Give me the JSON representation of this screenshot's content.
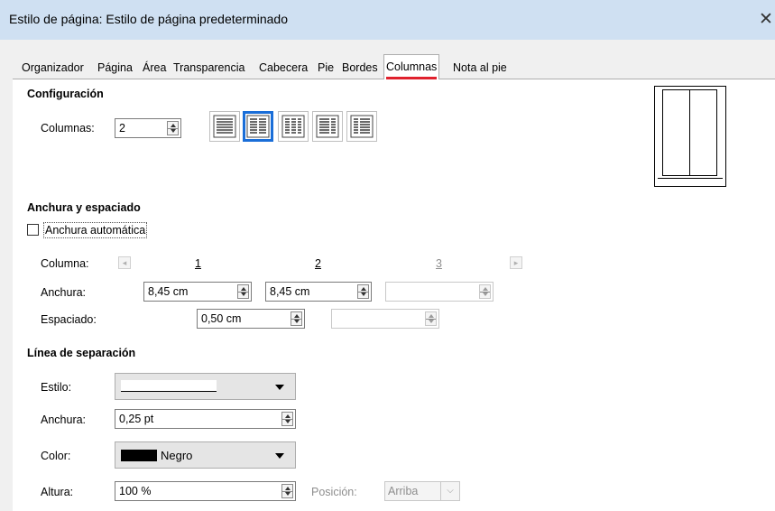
{
  "window": {
    "title": "Estilo de página: Estilo de página predeterminado",
    "close": "✕"
  },
  "tabs": [
    {
      "label": "Organizador"
    },
    {
      "label": "Página"
    },
    {
      "label": "Área"
    },
    {
      "label": "Transparencia"
    },
    {
      "label": "Cabecera"
    },
    {
      "label": "Pie"
    },
    {
      "label": "Bordes"
    },
    {
      "label": "Columnas",
      "active": true
    },
    {
      "label": "Nota al pie"
    }
  ],
  "configuracion": {
    "heading": "Configuración",
    "columns_label": "Columnas:",
    "columns_value": "2",
    "layouts": [
      {
        "name": "one-column",
        "selected": false
      },
      {
        "name": "two-columns",
        "selected": true
      },
      {
        "name": "three-columns",
        "selected": false
      },
      {
        "name": "two-columns-left-wide",
        "selected": false
      },
      {
        "name": "two-columns-right-wide",
        "selected": false
      }
    ]
  },
  "anchura_espaciado": {
    "heading": "Anchura y espaciado",
    "auto_width_label": "Anchura automática",
    "auto_width_checked": false,
    "column_label": "Columna:",
    "column_numbers": [
      "1",
      "2",
      "3"
    ],
    "width_label": "Anchura:",
    "widths": [
      "8,45 cm",
      "8,45 cm",
      ""
    ],
    "spacing_label": "Espaciado:",
    "spacings": [
      "0,50 cm",
      ""
    ]
  },
  "linea_separacion": {
    "heading": "Línea de separación",
    "style_label": "Estilo:",
    "width_label": "Anchura:",
    "width_value": "0,25 pt",
    "color_label": "Color:",
    "color_value": "Negro",
    "color_swatch": "#000000",
    "height_label": "Altura:",
    "height_value": "100 %",
    "position_label": "Posición:",
    "position_value": "Arriba"
  },
  "colors": {
    "accent": "#1a6ed8",
    "tab_underline": "#e0212d",
    "titlebar": "#cfe0f2"
  }
}
